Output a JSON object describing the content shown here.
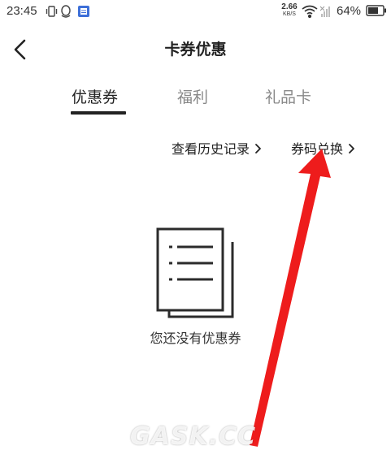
{
  "status_bar": {
    "time": "23:45",
    "net_speed_value": "2.66",
    "net_speed_unit": "KB/S",
    "battery_percent": "64%"
  },
  "header": {
    "title": "卡券优惠"
  },
  "tabs": [
    {
      "label": "优惠券",
      "active": true
    },
    {
      "label": "福利",
      "active": false
    },
    {
      "label": "礼品卡",
      "active": false
    }
  ],
  "links": {
    "history": "查看历史记录",
    "redeem": "券码兑换"
  },
  "empty_state": {
    "message": "您还没有优惠券"
  },
  "watermark": {
    "text": "GASK.CC"
  },
  "colors": {
    "text_primary": "#222222",
    "tab_inactive": "#888888",
    "annotation_arrow": "#ee1c1c",
    "watermark_dot": "#e8302c"
  },
  "icons": {
    "back": "chevron-left-icon",
    "link_chevron": "chevron-right-icon",
    "empty_state": "document-list-icon"
  }
}
